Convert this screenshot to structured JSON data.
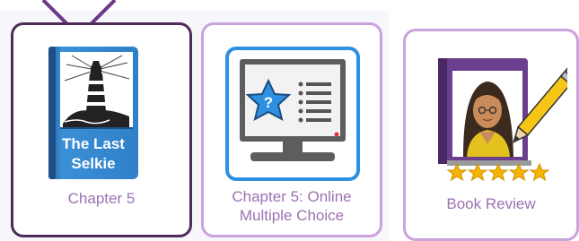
{
  "cards": [
    {
      "label": "Chapter 5",
      "book_title_line1": "The Last",
      "book_title_line2": "Selkie"
    },
    {
      "label_line1": "Chapter 5: Online",
      "label_line2": "Multiple Choice"
    },
    {
      "label": "Book Review",
      "rating": 5
    }
  ],
  "colors": {
    "selected_border": "#4e2b58",
    "card_border": "#c9a3dc",
    "label_text": "#9b72b3",
    "book_blue": "#2f80c8",
    "star": "#f5b400"
  }
}
